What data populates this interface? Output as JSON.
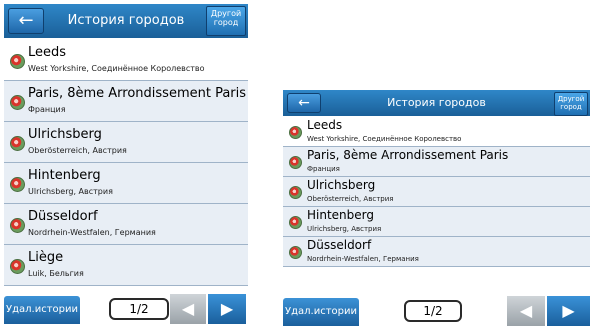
{
  "title": "История городов",
  "other_button": "Другой город",
  "back_icon": "←",
  "delete_button": "Удал.истории",
  "page": "1/2",
  "prev_icon": "◀",
  "next_icon": "▶",
  "portrait_rows": [
    {
      "name": "Leeds",
      "sub": "West Yorkshire, Соединённое Королевство"
    },
    {
      "name": "Paris, 8ème Arrondissement Paris",
      "sub": "Франция"
    },
    {
      "name": "Ulrichsberg",
      "sub": "Oberösterreich, Австрия"
    },
    {
      "name": "Hintenberg",
      "sub": "Ulrichsberg, Австрия"
    },
    {
      "name": "Düsseldorf",
      "sub": "Nordrhein-Westfalen, Германия"
    },
    {
      "name": "Liège",
      "sub": "Luik, Бельгия"
    }
  ],
  "landscape_rows": [
    {
      "name": "Leeds",
      "sub": "West Yorkshire, Соединённое Королевство"
    },
    {
      "name": "Paris, 8ème Arrondissement Paris",
      "sub": "Франция"
    },
    {
      "name": "Ulrichsberg",
      "sub": "Oberösterreich, Австрия"
    },
    {
      "name": "Hintenberg",
      "sub": "Ulrichsberg, Австрия"
    },
    {
      "name": "Düsseldorf",
      "sub": "Nordrhein-Westfalen, Германия"
    }
  ]
}
